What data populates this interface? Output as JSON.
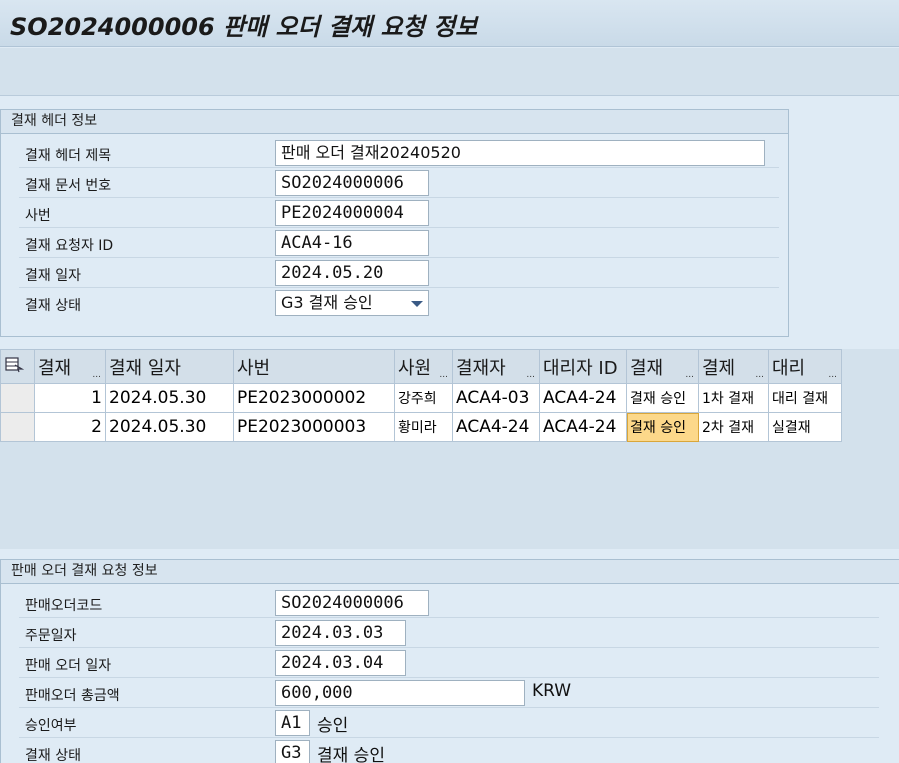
{
  "window": {
    "title": "SO2024000006 판매 오더 결재 요청 정보"
  },
  "header_group": {
    "title": "결재 헤더 정보",
    "fields": [
      {
        "label": "결재 헤더 제목",
        "value": "판매 오더 결재20240520"
      },
      {
        "label": "결재 문서 번호",
        "value": "SO2024000006"
      },
      {
        "label": "사번",
        "value": "PE2024000004"
      },
      {
        "label": "결재 요청자 ID",
        "value": "ACA4-16"
      },
      {
        "label": "결재 일자",
        "value": "2024.05.20"
      },
      {
        "label": "결재 상태",
        "value": "G3 결재 승인"
      }
    ]
  },
  "table": {
    "columns": [
      "결재",
      "결재 일자",
      "사번",
      "사원",
      "결재자",
      "대리자 ID",
      "결재",
      "결제",
      "대리"
    ],
    "rows": [
      [
        "1",
        "2024.05.30",
        "PE2023000002",
        "강주희",
        "ACA4-03",
        "ACA4-24",
        "결재 승인",
        "1차 결재",
        "대리 결재"
      ],
      [
        "2",
        "2024.05.30",
        "PE2023000003",
        "황미라",
        "ACA4-24",
        "ACA4-24",
        "결재 승인",
        "2차 결재",
        "실결재"
      ]
    ]
  },
  "order_group": {
    "title": "판매 오더 결재 요청 정보",
    "fields": [
      {
        "label": "판매오더코드",
        "value": "SO2024000006"
      },
      {
        "label": "주문일자",
        "value": "2024.03.03"
      },
      {
        "label": "판매 오더 일자",
        "value": "2024.03.04"
      },
      {
        "label": "판매오더 총금액",
        "value": "600,000",
        "suffix": "KRW"
      },
      {
        "label": "승인여부",
        "value": "A1",
        "suffix": "승인"
      },
      {
        "label": "결재 상태",
        "value": "G3",
        "suffix": "결재 승인"
      }
    ]
  }
}
